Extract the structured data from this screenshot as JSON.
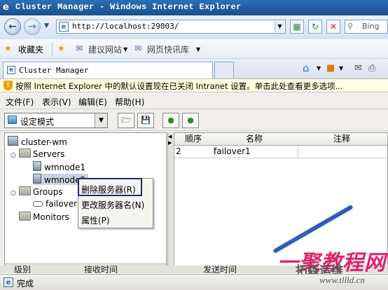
{
  "window": {
    "title": "Cluster Manager - Windows Internet Explorer",
    "icon": "ie-icon"
  },
  "address_bar": {
    "url": "http://localhost:29003/",
    "search_engine": "Bing"
  },
  "favorites_bar": {
    "favorites": "收藏夹",
    "suggested_sites": "建议网站",
    "web_slice": "网页快讯库"
  },
  "tab": {
    "title": "Cluster Manager"
  },
  "info_bar": {
    "text": "按照 Internet Explorer 中的默认设置现在已关闭 Intranet 设置。单击此处查看更多选项..."
  },
  "menu": {
    "file": "文件(F)",
    "view": "表示(V)",
    "edit": "编辑(E)",
    "help": "帮助(H)"
  },
  "toolbar": {
    "mode": "设定模式"
  },
  "tree": {
    "root": "cluster-wm",
    "servers": "Servers",
    "server1": "wmnode1",
    "server2": "wmnode2",
    "groups": "Groups",
    "group1": "failover1",
    "monitors": "Monitors"
  },
  "table": {
    "headers": [
      "顺序",
      "名称",
      "注释"
    ],
    "rows": [
      {
        "order": "2",
        "name": "failover1",
        "comment": ""
      }
    ]
  },
  "context_menu": {
    "delete_server": "删除服务器(R)",
    "rename_server": "更改服务器名(N)",
    "properties": "属性(P)"
  },
  "log_headers": {
    "level": "级别",
    "received_time": "接收时间",
    "sent_time": "发送时间"
  },
  "status": {
    "text": "完成"
  },
  "watermark": {
    "line1": "一聚教程网",
    "line2": "拓森运维",
    "line3": "www.tllld.cn"
  },
  "colors": {
    "title_bar": "#1a4f8c",
    "info_bar": "#ffffe1",
    "watermark": "#e0246b",
    "selection_frame": "#1e2a78"
  }
}
